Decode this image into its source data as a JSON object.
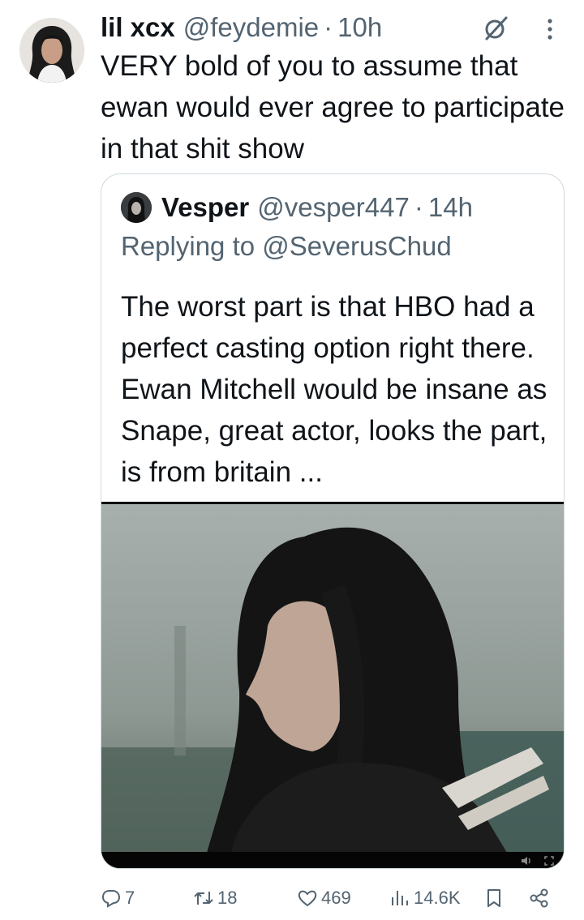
{
  "tweet": {
    "display_name": "lil xcx",
    "handle": "@feydemie",
    "separator": "·",
    "time": "10h",
    "text": "VERY bold of you to assume that ewan would ever agree to participate in that shit show"
  },
  "quote": {
    "display_name": "Vesper",
    "handle": "@vesper447",
    "separator": "·",
    "time": "14h",
    "replying_to": "Replying to @SeverusChud",
    "text": "The worst part is that HBO had a perfect casting option right there. Ewan Mitchell would be insane as Snape, great actor, looks the part, is from britain ..."
  },
  "actions": {
    "replies": "7",
    "reposts": "18",
    "likes": "469",
    "views": "14.6K"
  },
  "colors": {
    "text": "#0f1419",
    "secondary": "#536471",
    "border": "#cfd9de"
  },
  "icons": [
    "brand-icon",
    "more-icon",
    "reply-icon",
    "repost-icon",
    "like-icon",
    "views-icon",
    "bookmark-icon",
    "share-icon",
    "volume-icon",
    "fullscreen-icon"
  ]
}
